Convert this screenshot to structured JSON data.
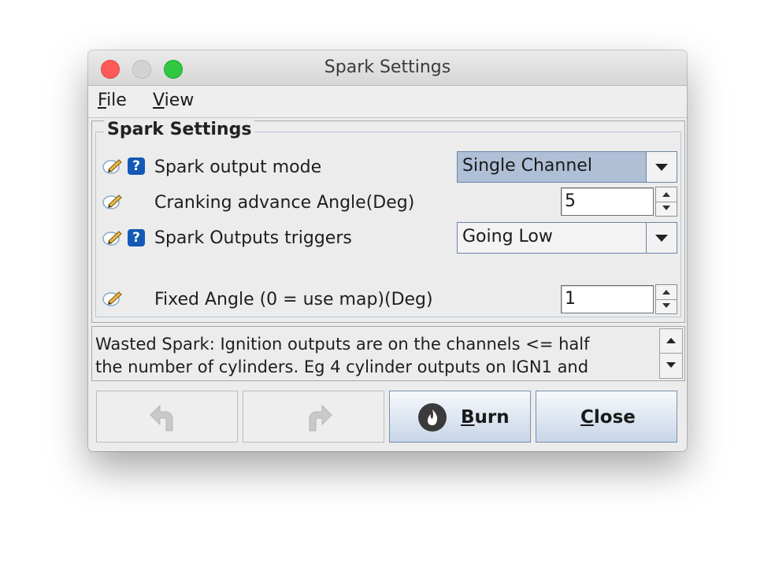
{
  "window": {
    "title": "Spark Settings"
  },
  "menu": {
    "file_mnemonic": "F",
    "file_rest": "ile",
    "view_mnemonic": "V",
    "view_rest": "iew"
  },
  "panel": {
    "legend": "Spark Settings",
    "rows": [
      {
        "label": "Spark output mode",
        "type": "combo",
        "value": "Single Channel",
        "has_help": true
      },
      {
        "label": "Cranking advance Angle(Deg)",
        "type": "spinner",
        "value": "5",
        "has_help": false
      },
      {
        "label": "Spark Outputs triggers",
        "type": "combo",
        "value": "Going Low",
        "has_help": true
      },
      {
        "label": "Fixed Angle (0 = use map)(Deg)",
        "type": "spinner",
        "value": "1",
        "has_help": false
      }
    ]
  },
  "description": {
    "line1": "Wasted Spark: Ignition outputs are on the channels <= half",
    "line2": "the number of cylinders. Eg 4 cylinder outputs on IGN1 and"
  },
  "buttons": {
    "undo_icon": "undo-icon",
    "redo_icon": "redo-icon",
    "burn_mnemonic": "B",
    "burn_rest": "urn",
    "close_mnemonic": "C",
    "close_rest": "lose"
  },
  "icons": {
    "edit": "edit-pencil-icon",
    "help": "help-question-icon",
    "help_glyph": "?"
  },
  "colors": {
    "selected_combo": "#aebfd6",
    "help_icon": "#1459b5",
    "close_light": "#fc5b57",
    "maximize_light": "#2fc840"
  }
}
